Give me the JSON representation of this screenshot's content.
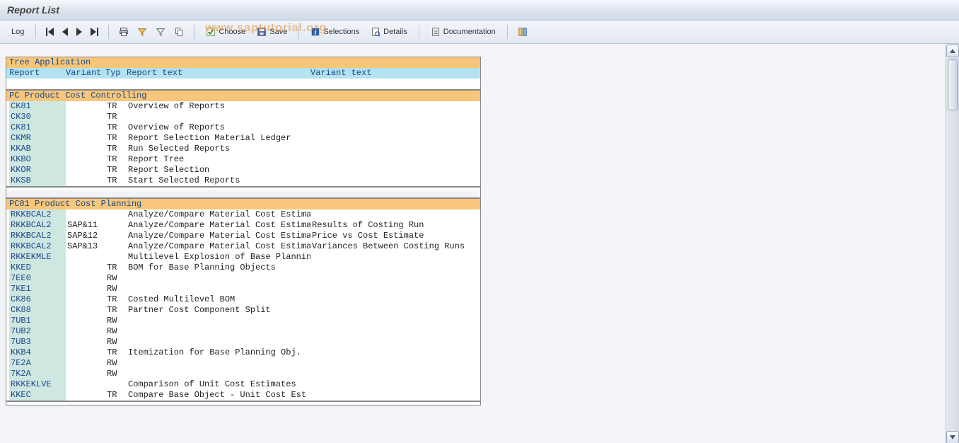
{
  "title": "Report List",
  "watermark": "www.saptutorial.org",
  "toolbar": {
    "log": "Log",
    "choose": "Choose",
    "save": "Save",
    "selections": "Selections",
    "details": "Details",
    "documentation": "Documentation"
  },
  "panel": {
    "header": "Tree Application",
    "columns": {
      "report": "Report",
      "variant": "Variant",
      "typ": "Typ",
      "report_text": "Report text",
      "variant_text": "Variant text"
    }
  },
  "groups": [
    {
      "code": "PC",
      "title": "Product Cost Controlling",
      "rows": [
        {
          "report": "CK81",
          "variant": "",
          "typ": "TR",
          "report_text": "Overview of Reports",
          "variant_text": ""
        },
        {
          "report": "CK30",
          "variant": "",
          "typ": "TR",
          "report_text": "",
          "variant_text": ""
        },
        {
          "report": "CK81",
          "variant": "",
          "typ": "TR",
          "report_text": "Overview of Reports",
          "variant_text": ""
        },
        {
          "report": "CKMR",
          "variant": "",
          "typ": "TR",
          "report_text": "Report Selection Material Ledger",
          "variant_text": ""
        },
        {
          "report": "KKAB",
          "variant": "",
          "typ": "TR",
          "report_text": "Run Selected Reports",
          "variant_text": ""
        },
        {
          "report": "KKBO",
          "variant": "",
          "typ": "TR",
          "report_text": "Report Tree",
          "variant_text": ""
        },
        {
          "report": "KKOR",
          "variant": "",
          "typ": "TR",
          "report_text": "Report Selection",
          "variant_text": ""
        },
        {
          "report": "KKSB",
          "variant": "",
          "typ": "TR",
          "report_text": "Start Selected Reports",
          "variant_text": ""
        }
      ]
    },
    {
      "code": "PC01",
      "title": "Product Cost Planning",
      "rows": [
        {
          "report": "RKKBCAL2",
          "variant": "",
          "typ": "",
          "report_text": "Analyze/Compare Material Cost Estimates",
          "variant_text": ""
        },
        {
          "report": "RKKBCAL2",
          "variant": "SAP&11",
          "typ": "",
          "report_text": "Analyze/Compare Material Cost Estimates",
          "variant_text": "Results of Costing Run"
        },
        {
          "report": "RKKBCAL2",
          "variant": "SAP&12",
          "typ": "",
          "report_text": "Analyze/Compare Material Cost Estimates",
          "variant_text": "Price vs Cost Estimate"
        },
        {
          "report": "RKKBCAL2",
          "variant": "SAP&13",
          "typ": "",
          "report_text": "Analyze/Compare Material Cost Estimates",
          "variant_text": "Variances Between Costing Runs"
        },
        {
          "report": "RKKEKMLE",
          "variant": "",
          "typ": "",
          "report_text": "Multilevel Explosion of Base Planning Ob",
          "variant_text": ""
        },
        {
          "report": "KKED",
          "variant": "",
          "typ": "TR",
          "report_text": "BOM for Base Planning Objects",
          "variant_text": ""
        },
        {
          "report": "7EE0",
          "variant": "",
          "typ": "RW",
          "report_text": "",
          "variant_text": ""
        },
        {
          "report": "7KE1",
          "variant": "",
          "typ": "RW",
          "report_text": "",
          "variant_text": ""
        },
        {
          "report": "CK86",
          "variant": "",
          "typ": "TR",
          "report_text": "Costed Multilevel BOM",
          "variant_text": ""
        },
        {
          "report": "CK88",
          "variant": "",
          "typ": "TR",
          "report_text": "Partner Cost Component Split",
          "variant_text": ""
        },
        {
          "report": "7UB1",
          "variant": "",
          "typ": "RW",
          "report_text": "",
          "variant_text": ""
        },
        {
          "report": "7UB2",
          "variant": "",
          "typ": "RW",
          "report_text": "",
          "variant_text": ""
        },
        {
          "report": "7UB3",
          "variant": "",
          "typ": "RW",
          "report_text": "",
          "variant_text": ""
        },
        {
          "report": "KKB4",
          "variant": "",
          "typ": "TR",
          "report_text": "Itemization for Base Planning Obj.",
          "variant_text": ""
        },
        {
          "report": "7E2A",
          "variant": "",
          "typ": "RW",
          "report_text": "",
          "variant_text": ""
        },
        {
          "report": "7K2A",
          "variant": "",
          "typ": "RW",
          "report_text": "",
          "variant_text": ""
        },
        {
          "report": "RKKEKLVE",
          "variant": "",
          "typ": "",
          "report_text": "Comparison of Unit Cost Estimates",
          "variant_text": ""
        },
        {
          "report": "KKEC",
          "variant": "",
          "typ": "TR",
          "report_text": "Compare Base Object - Unit Cost Est",
          "variant_text": ""
        }
      ]
    }
  ]
}
